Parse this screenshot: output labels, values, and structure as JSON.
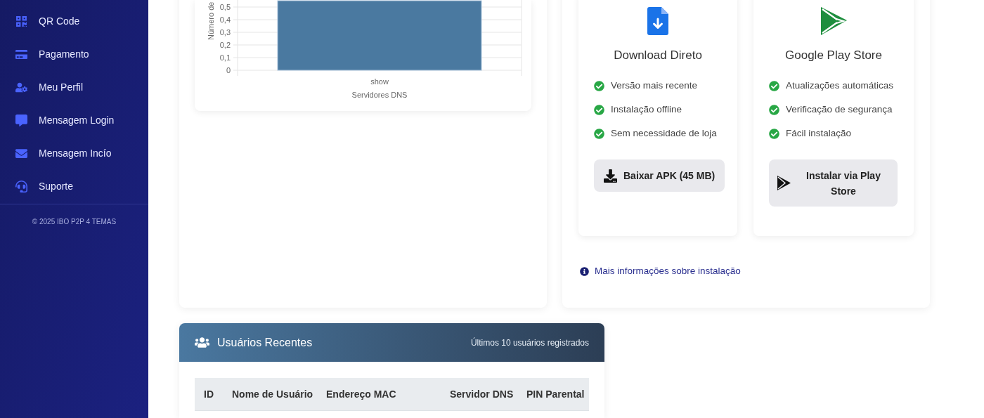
{
  "sidebar": {
    "items": [
      {
        "label": "QR Code"
      },
      {
        "label": "Pagamento"
      },
      {
        "label": "Meu Perfil"
      },
      {
        "label": "Mensagem Login"
      },
      {
        "label": "Mensagem Incío"
      },
      {
        "label": "Suporte"
      }
    ],
    "footer": "© 2025 IBO P2P 4 TEMAS"
  },
  "dns_chart": {
    "chart_data": {
      "type": "bar",
      "categories": [
        "show"
      ],
      "ylabel": "Número de",
      "xlabel": "Servidores DNS",
      "grid": true,
      "ylim": [
        0,
        0.55
      ],
      "yticks": [
        {
          "value": 0,
          "label": "0"
        },
        {
          "value": 0.1,
          "label": "0,1"
        },
        {
          "value": 0.2,
          "label": "0,2"
        },
        {
          "value": 0.3,
          "label": "0,3"
        },
        {
          "value": 0.4,
          "label": "0,4"
        },
        {
          "value": 0.5,
          "label": "0,5"
        }
      ],
      "series": [
        {
          "color": "#4a79a0",
          "values": [
            0.55
          ]
        }
      ]
    }
  },
  "download_options": [
    {
      "kind": "apk",
      "title": "Download Direto",
      "features": [
        "Versão mais recente",
        "Instalação offline",
        "Sem necessidade de loja"
      ],
      "button": "Baixar APK (45 MB)"
    },
    {
      "kind": "play",
      "title": "Google Play Store",
      "features": [
        "Atualizações automáticas",
        "Verificação de segurança",
        "Fácil instalação"
      ],
      "button": "Instalar via Play Store"
    }
  ],
  "info_link": "Mais informações sobre instalação",
  "recent_users": {
    "title": "Usuários Recentes",
    "subtitle": "Últimos 10 usuários registrados",
    "columns": [
      "ID",
      "Nome de Usuário",
      "Endereço MAC",
      "Servidor DNS",
      "PIN Parental"
    ]
  }
}
